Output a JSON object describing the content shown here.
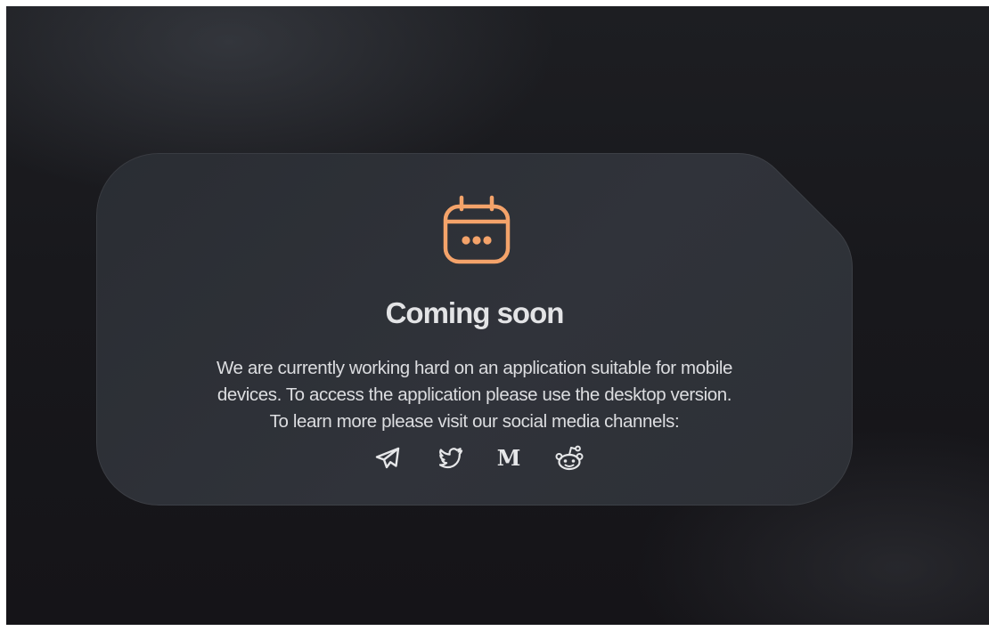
{
  "notice": {
    "icon": "calendar-dots-icon",
    "title": "Coming soon",
    "message_lines": [
      "We are currently working hard on an application suitable for mobile",
      "devices. To access the application please use the desktop version.",
      "To learn more please visit our social media channels:"
    ]
  },
  "social_links": [
    {
      "name": "telegram",
      "icon": "telegram-icon"
    },
    {
      "name": "twitter",
      "icon": "twitter-icon"
    },
    {
      "name": "medium",
      "icon": "medium-icon",
      "glyph": "M"
    },
    {
      "name": "reddit",
      "icon": "reddit-icon"
    }
  ],
  "colors": {
    "accent": "#f4a36a",
    "title_text": "#e3e4e6",
    "body_text": "#dcdde0",
    "card_background": "#2e3137",
    "page_background": "#18181c"
  }
}
